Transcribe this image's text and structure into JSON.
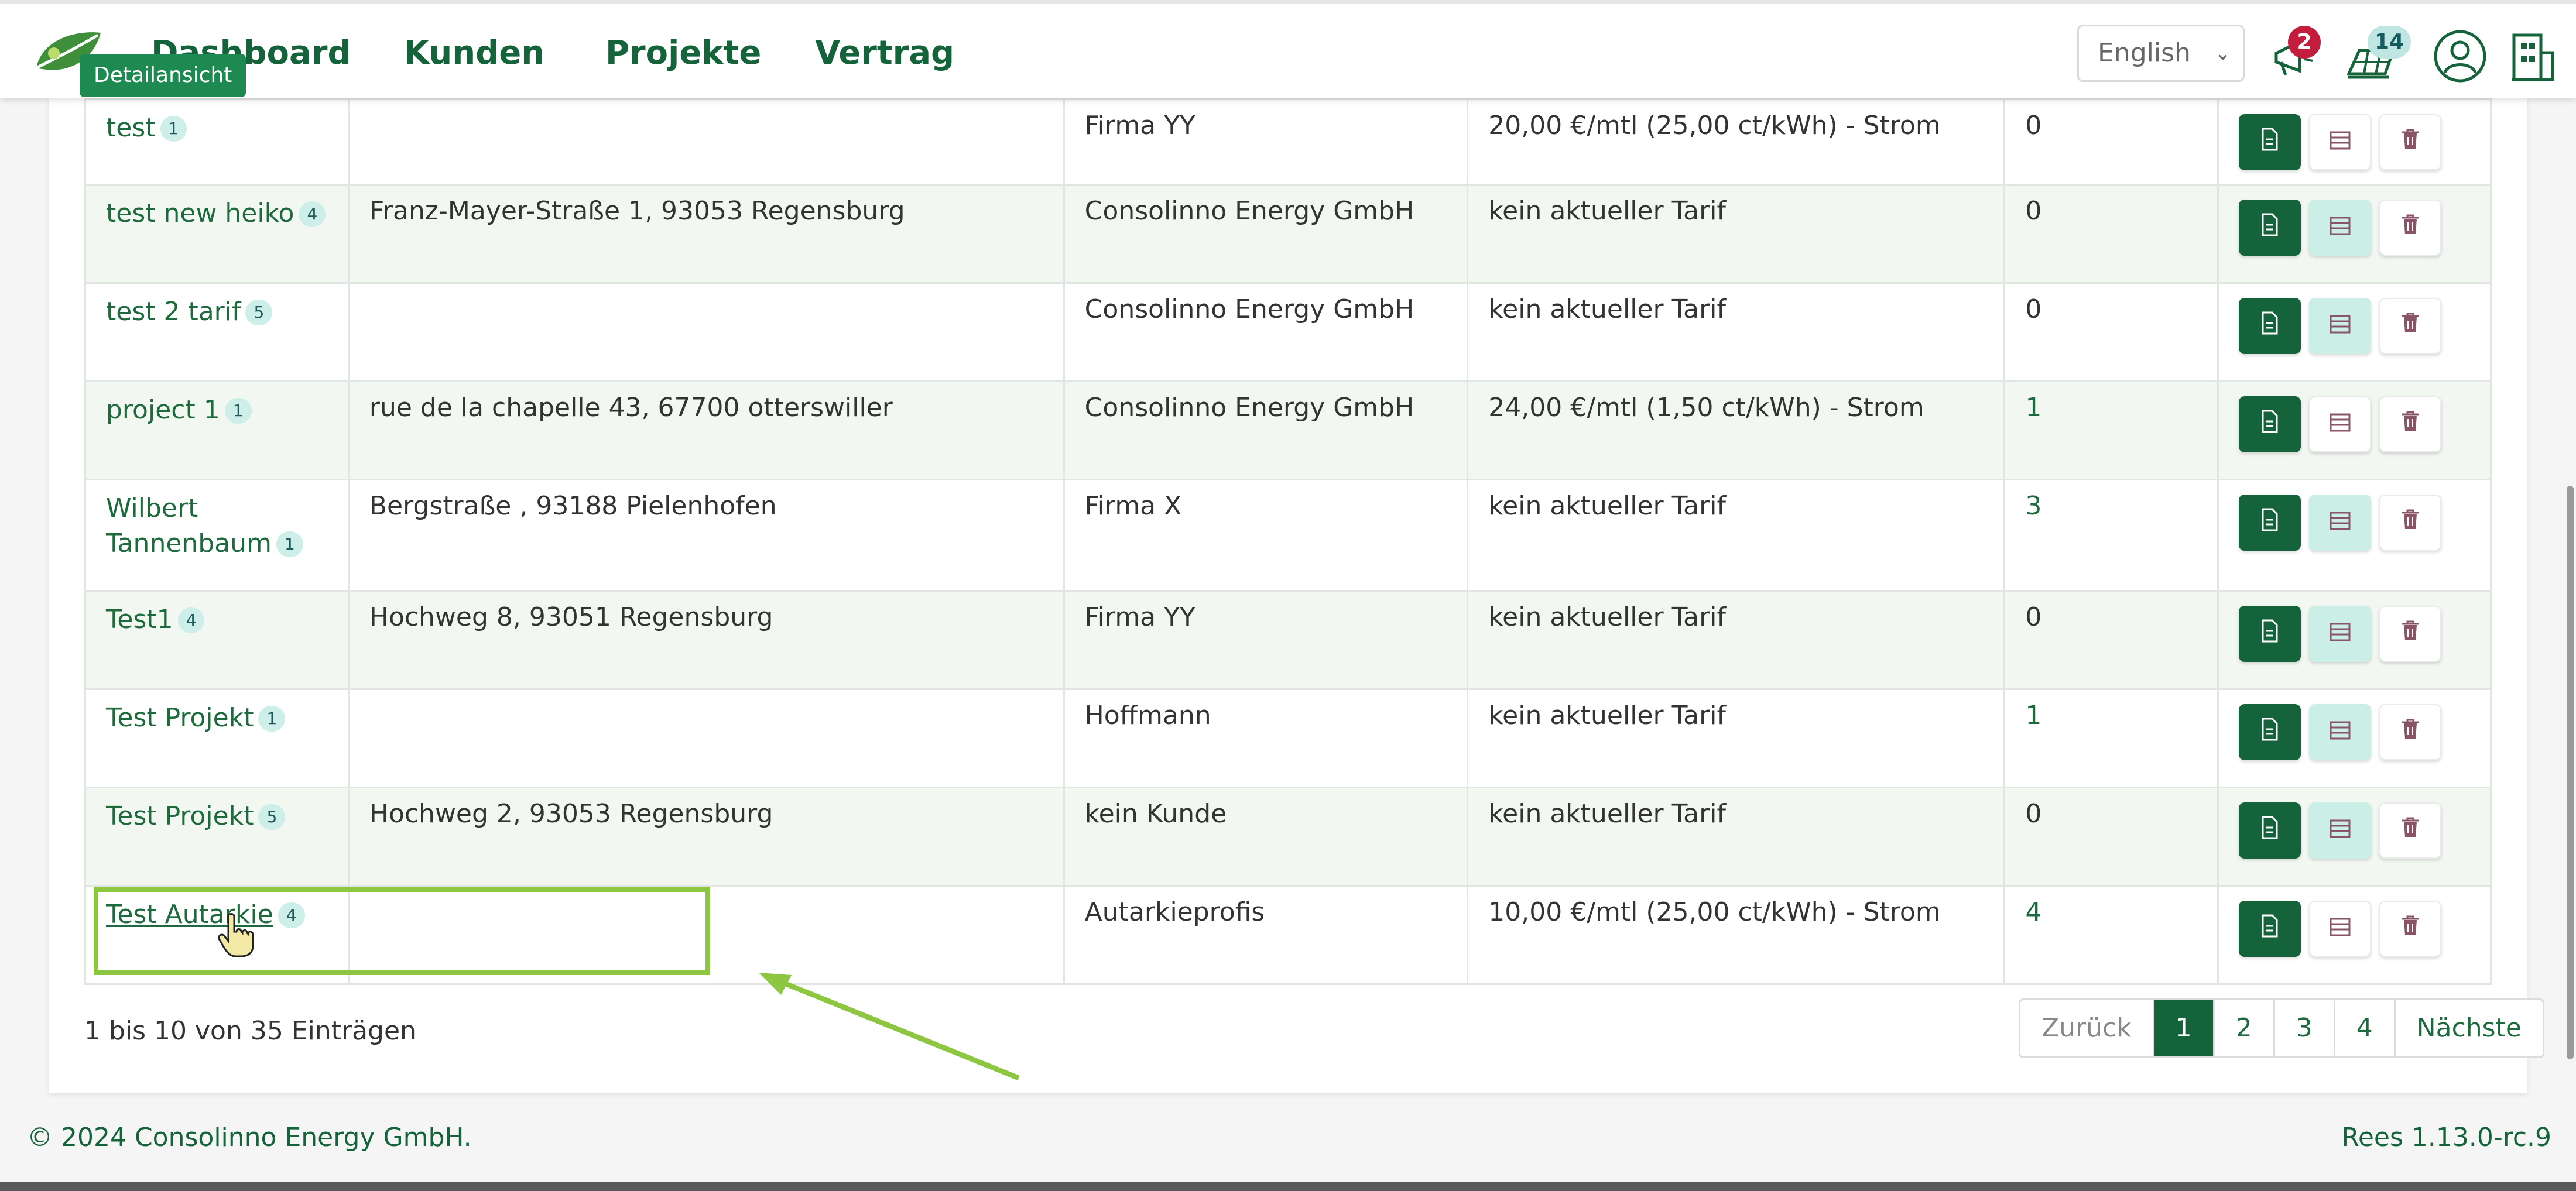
{
  "nav": {
    "items": [
      "Dashboard",
      "Kunden",
      "Projekte",
      "Vertrag"
    ],
    "tooltip": "Detailansicht",
    "language": "English",
    "notifications_count": "2",
    "messages_count": "14"
  },
  "table": {
    "rows": [
      {
        "name": "test",
        "count": "1",
        "address": "",
        "customer": "Firma YY",
        "tariff": "20,00 €/mtl (25,00 ct/kWh) - Strom",
        "number": "0"
      },
      {
        "name": "test new heiko",
        "count": "4",
        "address": "Franz-Mayer-Straße 1, 93053 Regensburg",
        "customer": "Consolinno Energy GmbH",
        "tariff": "kein aktueller Tarif",
        "number": "0"
      },
      {
        "name": "test 2 tarif",
        "count": "5",
        "address": "",
        "customer": "Consolinno Energy GmbH",
        "tariff": "kein aktueller Tarif",
        "number": "0"
      },
      {
        "name": "project 1",
        "count": "1",
        "address": "rue de la chapelle 43, 67700 otterswiller",
        "customer": "Consolinno Energy GmbH",
        "tariff": "24,00 €/mtl (1,50 ct/kWh) - Strom",
        "number": "1"
      },
      {
        "name_line1": "Wilbert",
        "name_line2": "Tannenbaum",
        "count": "1",
        "address": "Bergstraße , 93188 Pielenhofen",
        "customer": "Firma X",
        "tariff": "kein aktueller Tarif",
        "number": "3"
      },
      {
        "name": "Test1",
        "count": "4",
        "address": "Hochweg 8, 93051 Regensburg",
        "customer": "Firma YY",
        "tariff": "kein aktueller Tarif",
        "number": "0"
      },
      {
        "name": "Test Projekt",
        "count": "1",
        "address": "",
        "customer": "Hoffmann",
        "tariff": "kein aktueller Tarif",
        "number": "1"
      },
      {
        "name": "Test Projekt",
        "count": "5",
        "address": "Hochweg 2, 93053 Regensburg",
        "customer": "kein Kunde",
        "tariff": "kein aktueller Tarif",
        "number": "0"
      },
      {
        "name": "Test Autarkie",
        "count": "4",
        "address": "",
        "customer": "Autarkieprofis",
        "tariff": "10,00 €/mtl (25,00 ct/kWh) - Strom",
        "number": "4"
      }
    ]
  },
  "pagination": {
    "summary": "1 bis 10 von 35 Einträgen",
    "prev": "Zurück",
    "pages": [
      "1",
      "2",
      "3",
      "4"
    ],
    "next": "Nächste"
  },
  "footer": {
    "copyright": "© 2024 Consolinno Energy GmbH.",
    "version": "Rees 1.13.0-rc.9"
  },
  "colors": {
    "brand": "#15633a",
    "highlight": "#8dc641",
    "badge_red": "#c21d3c"
  }
}
